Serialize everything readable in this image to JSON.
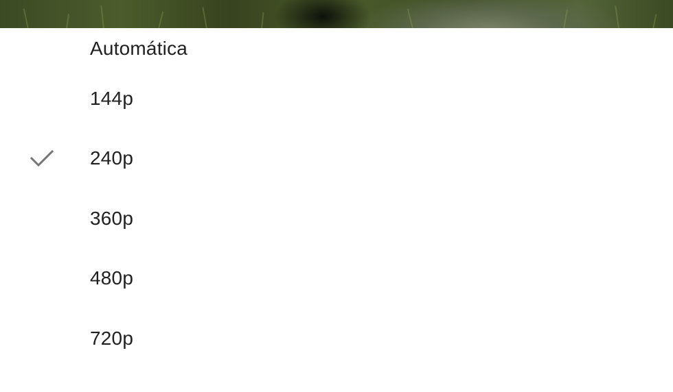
{
  "quality_menu": {
    "options": [
      {
        "label": "Automática",
        "selected": false
      },
      {
        "label": "144p",
        "selected": false
      },
      {
        "label": "240p",
        "selected": true
      },
      {
        "label": "360p",
        "selected": false
      },
      {
        "label": "480p",
        "selected": false
      },
      {
        "label": "720p",
        "selected": false
      }
    ],
    "selected_icon": "checkmark-icon"
  },
  "colors": {
    "sheet_background": "#ffffff",
    "option_text": "#212121",
    "checkmark": "#757575"
  }
}
